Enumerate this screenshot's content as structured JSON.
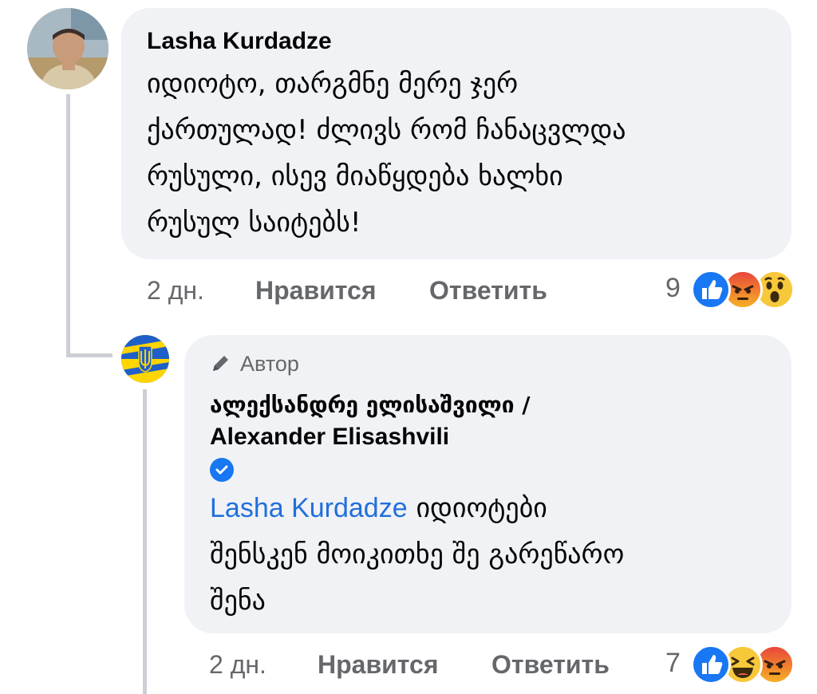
{
  "comment": {
    "author": "Lasha Kurdadze",
    "text_lines": [
      "იდიოტო, თარგმნე მერე ჯერ",
      "ქართულად! ძლივს რომ ჩანაცვლდა",
      "რუსული, ისევ მიაწყდება ხალხი",
      "რუსულ საიტებს!"
    ],
    "time": "2 дн.",
    "like_label": "Нравится",
    "reply_label": "Ответить",
    "reaction_count": "9",
    "reactions": [
      "like-icon",
      "angry-icon",
      "wow-icon"
    ]
  },
  "reply": {
    "badge": "Автор",
    "author_line1": "ალექსანდრე ელისაშვილი /",
    "author_line2": "Alexander Elisashvili",
    "verified": true,
    "mention": "Lasha Kurdadze",
    "text_line1_rest": " იდიოტები",
    "text_lines": [
      "შენსკენ მოიკითხე შე გარეწარო",
      "შენა"
    ],
    "time": "2 дн.",
    "like_label": "Нравится",
    "reply_label": "Ответить",
    "reaction_count": "7",
    "reactions": [
      "like-icon",
      "haha-icon",
      "angry-icon"
    ]
  },
  "colors": {
    "bubble": "#f0f2f5",
    "link": "#216fdb",
    "secondary_text": "#65676b",
    "like_blue": "#1877f2",
    "thread_line": "#ccd0d5"
  }
}
